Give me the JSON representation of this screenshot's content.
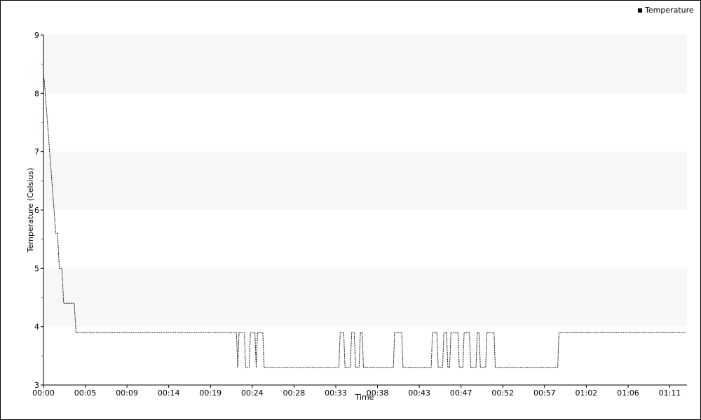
{
  "chart_data": {
    "type": "line",
    "xlabel": "Time",
    "ylabel": "Temperature (Celsius)",
    "legend": {
      "position": "top-right",
      "entries": [
        "Temperature"
      ]
    },
    "ylim": [
      3,
      9
    ],
    "y_ticks": [
      "3",
      "4",
      "5",
      "6",
      "7",
      "8",
      "9"
    ],
    "xlim_minutes": [
      0,
      73.2
    ],
    "x_ticks": [
      {
        "label": "00:00",
        "minutes": 0
      },
      {
        "label": "00:05",
        "minutes": 4.75
      },
      {
        "label": "00:09",
        "minutes": 9.5
      },
      {
        "label": "00:14",
        "minutes": 14.25
      },
      {
        "label": "00:19",
        "minutes": 19.0
      },
      {
        "label": "00:24",
        "minutes": 23.75
      },
      {
        "label": "00:28",
        "minutes": 28.5
      },
      {
        "label": "00:33",
        "minutes": 33.25
      },
      {
        "label": "00:38",
        "minutes": 38.0
      },
      {
        "label": "00:43",
        "minutes": 42.75
      },
      {
        "label": "00:47",
        "minutes": 47.5
      },
      {
        "label": "00:52",
        "minutes": 52.25
      },
      {
        "label": "00:57",
        "minutes": 57.0
      },
      {
        "label": "01:02",
        "minutes": 61.75
      },
      {
        "label": "01:06",
        "minutes": 66.5
      },
      {
        "label": "01:11",
        "minutes": 71.25
      }
    ],
    "grid": "alternating horizontal bands",
    "colors": {
      "line": "#000000",
      "band": "#f7f7f7",
      "axis": "#000000",
      "minor_tick": "#cc0000"
    },
    "series": [
      {
        "name": "Temperature",
        "line_style": "dotted",
        "step": true,
        "x": [
          0,
          0.1,
          1.4,
          1.6,
          1.8,
          2.1,
          2.3,
          2.6,
          3.5,
          3.7,
          73
        ],
        "y": [
          8.3,
          8.2,
          5.6,
          5.6,
          5.0,
          5.0,
          4.4,
          4.4,
          4.4,
          3.9,
          3.9
        ],
        "dips": [
          [
            21.95,
            22.25
          ],
          [
            22.85,
            23.55
          ],
          [
            24.05,
            24.35
          ],
          [
            24.95,
            33.75
          ],
          [
            34.15,
            35.05
          ],
          [
            35.35,
            36.05
          ],
          [
            36.25,
            39.95
          ],
          [
            40.75,
            44.25
          ],
          [
            44.75,
            45.55
          ],
          [
            45.85,
            46.35
          ],
          [
            47.15,
            47.85
          ],
          [
            48.45,
            49.35
          ],
          [
            49.55,
            50.45
          ],
          [
            51.25,
            58.65
          ]
        ],
        "dip_value": 3.3,
        "high_value": 3.9
      }
    ]
  }
}
